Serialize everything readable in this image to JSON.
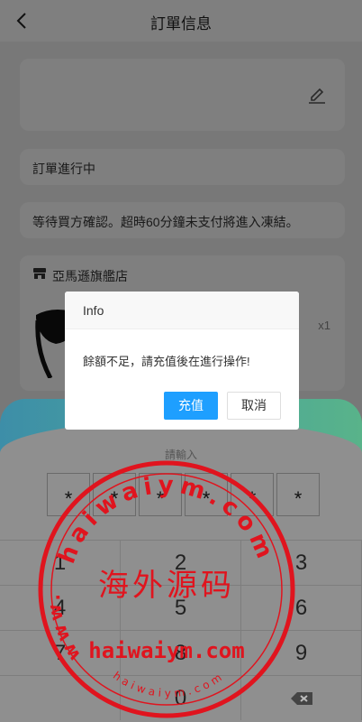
{
  "nav": {
    "title": "訂單信息",
    "back_icon": "chevron-left-icon"
  },
  "order": {
    "status": "訂單進行中",
    "note": "等待買方確認。超時60分鐘未支付將進入凍結。",
    "shop_name": "亞馬遜旗艦店",
    "quantity": "x1"
  },
  "dialog": {
    "title": "Info",
    "message": "餘額不足，請充值後在進行操作!",
    "confirm_label": "充值",
    "cancel_label": "取消"
  },
  "keyboard": {
    "hint": "請輸入",
    "pin": [
      "*",
      "*",
      "*",
      "*",
      "*",
      "*"
    ],
    "keys": [
      "1",
      "2",
      "3",
      "4",
      "5",
      "6",
      "7",
      "8",
      "9",
      "",
      "0",
      "delete"
    ]
  },
  "watermark": {
    "top_arc": "haiwaiym.com",
    "left_arc": "www.",
    "center": "海外源码",
    "domain": "haiwaiym.com",
    "bottom_arc": "haiwaiym.com",
    "color": "#e0141e"
  },
  "colors": {
    "accent": "#1e9fff"
  }
}
